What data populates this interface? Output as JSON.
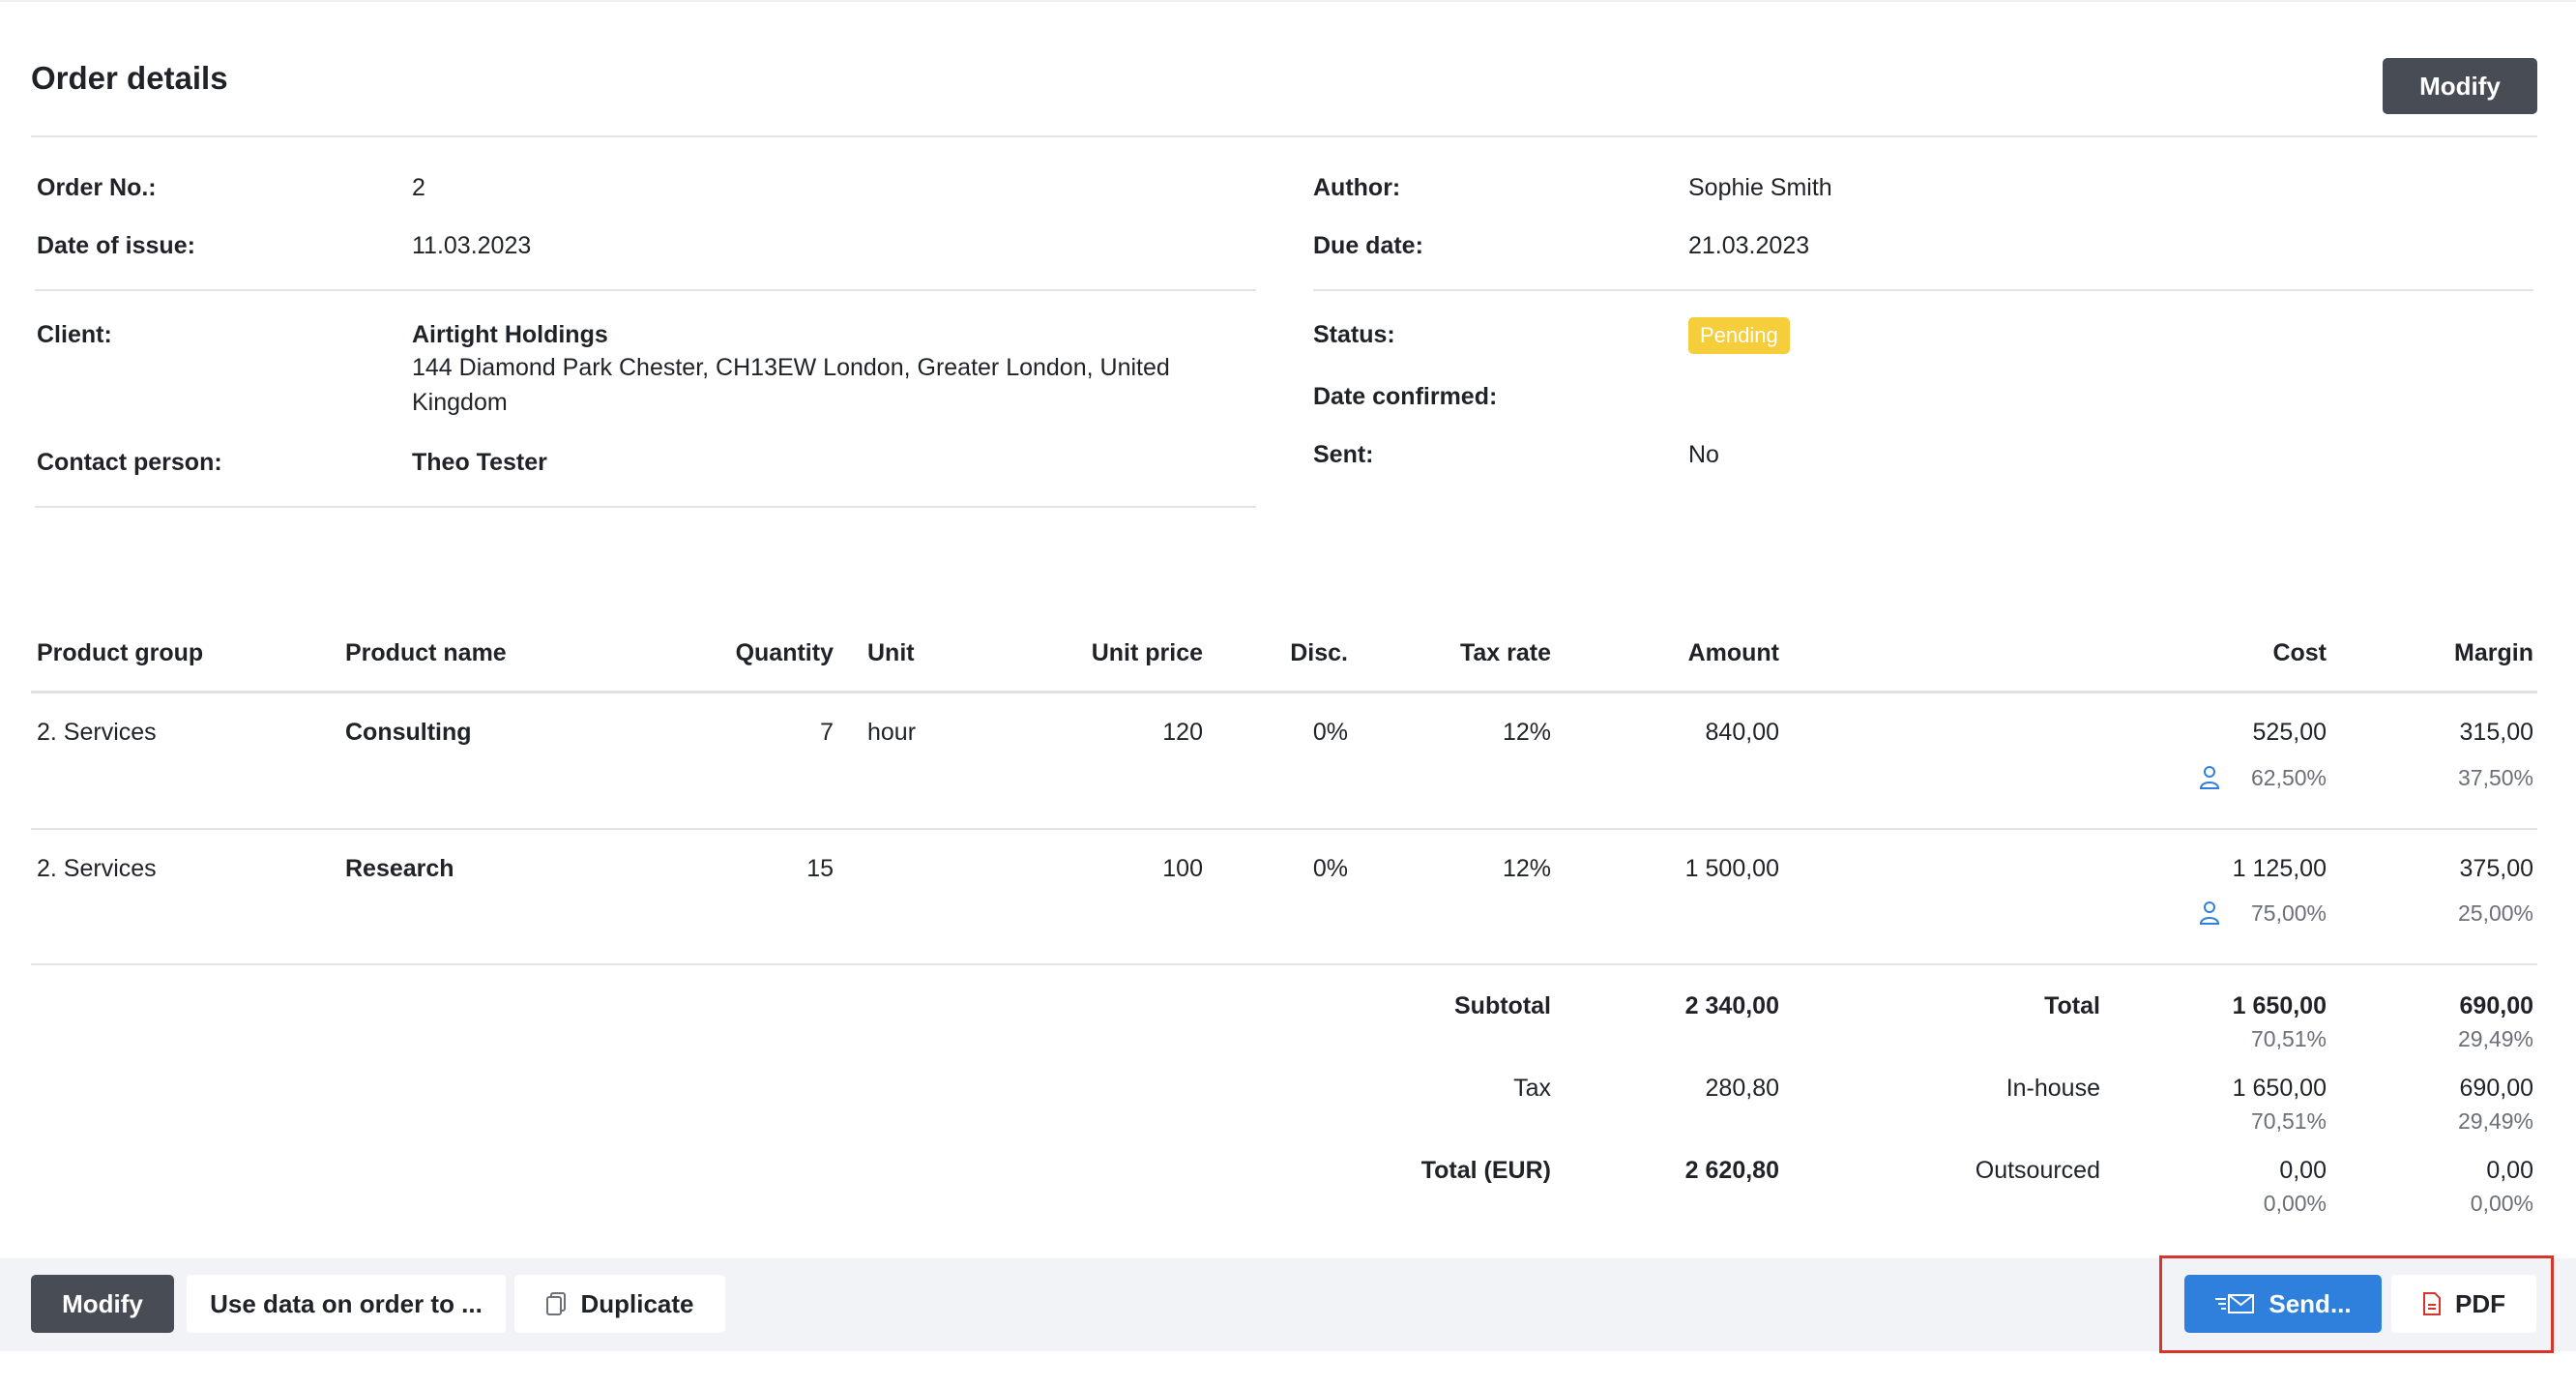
{
  "header": {
    "title": "Order details",
    "modify_label": "Modify"
  },
  "details": {
    "order_no_label": "Order No.:",
    "order_no": "2",
    "date_issue_label": "Date of issue:",
    "date_issue": "11.03.2023",
    "client_label": "Client:",
    "client_name": "Airtight Holdings",
    "client_address": "144 Diamond Park Chester, CH13EW London, Greater London, United Kingdom",
    "contact_label": "Contact person:",
    "contact": "Theo Tester",
    "author_label": "Author:",
    "author": "Sophie Smith",
    "due_label": "Due date:",
    "due": "21.03.2023",
    "status_label": "Status:",
    "status": "Pending",
    "confirmed_label": "Date confirmed:",
    "sent_label": "Sent:",
    "sent": "No"
  },
  "table": {
    "headers": [
      "Product group",
      "Product name",
      "Quantity",
      "Unit",
      "Unit price",
      "Disc.",
      "Tax rate",
      "Amount",
      "Cost",
      "Margin"
    ],
    "rows": [
      {
        "group": "2. Services",
        "name": "Consulting",
        "qty": "7",
        "unit": "hour",
        "price": "120",
        "disc": "0%",
        "tax": "12%",
        "amount": "840,00",
        "cost": "525,00",
        "cost_pct": "62,50%",
        "margin": "315,00",
        "margin_pct": "37,50%"
      },
      {
        "group": "2. Services",
        "name": "Research",
        "qty": "15",
        "unit": "",
        "price": "100",
        "disc": "0%",
        "tax": "12%",
        "amount": "1 500,00",
        "cost": "1 125,00",
        "cost_pct": "75,00%",
        "margin": "375,00",
        "margin_pct": "25,00%"
      }
    ]
  },
  "totals": {
    "subtotal_label": "Subtotal",
    "subtotal": "2 340,00",
    "tax_label": "Tax",
    "tax": "280,80",
    "total_label": "Total (EUR)",
    "total": "2 620,80",
    "total_cost_label": "Total",
    "total_cost": "1 650,00",
    "total_cost_pct": "70,51%",
    "total_margin": "690,00",
    "total_margin_pct": "29,49%",
    "inhouse_label": "In-house",
    "inhouse_cost": "1 650,00",
    "inhouse_cost_pct": "70,51%",
    "inhouse_margin": "690,00",
    "inhouse_margin_pct": "29,49%",
    "outsourced_label": "Outsourced",
    "outsourced_cost": "0,00",
    "outsourced_cost_pct": "0,00%",
    "outsourced_margin": "0,00",
    "outsourced_margin_pct": "0,00%"
  },
  "footer": {
    "modify_label": "Modify",
    "use_data_label": "Use data on order to ...",
    "duplicate_label": "Duplicate",
    "send_label": "Send...",
    "pdf_label": "PDF"
  },
  "colors": {
    "status_badge": "#f6cd3a",
    "send_button": "#2f7fdc",
    "dark_button": "#474c55",
    "highlight": "#d9342b"
  }
}
